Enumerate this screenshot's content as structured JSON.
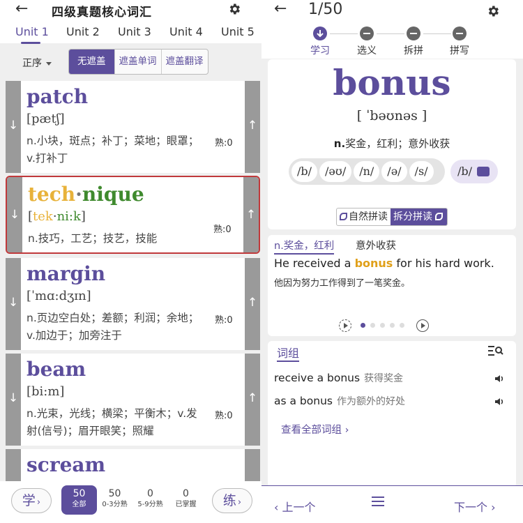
{
  "left": {
    "back_icon": "arrow-left-icon",
    "title": "四级真题核心词汇",
    "settings_icon": "gear-icon",
    "units": [
      "Unit 1",
      "Unit 2",
      "Unit 3",
      "Unit 4",
      "Unit 5"
    ],
    "active_unit": "Unit 1",
    "order_label": "正序",
    "cover_options": [
      "无遮盖",
      "遮盖单词",
      "遮盖翻译"
    ],
    "active_cover": "无遮盖",
    "words": [
      {
        "word": "patch",
        "phonetic": "[pætʃ]",
        "definition": "n.小块，斑点；补丁；菜地；眼罩；v.打补丁",
        "familiarity": "熟:0"
      },
      {
        "word_part1": "tech",
        "word_sep": "·",
        "word_part2": "nique",
        "phon_open": "[",
        "phon_part1": "tek",
        "phon_sep": "·",
        "phon_part2": "ni:k",
        "phon_close": "]",
        "definition": "n.技巧，工艺；技艺，技能",
        "familiarity": "熟:0"
      },
      {
        "word": "margin",
        "phonetic": "[ˈmɑ:dʒɪn]",
        "definition": "n.页边空白处；差额；利润；余地；v.加边于；加旁注于",
        "familiarity": "熟:0"
      },
      {
        "word": "beam",
        "phonetic": "[bi:m]",
        "definition": "n.光束，光线；横梁；平衡木；v.发射(信号)；眉开眼笑；照耀",
        "familiarity": "熟:0"
      },
      {
        "word": "scream"
      }
    ],
    "learn_button": "学",
    "practice_button": "练",
    "stats": [
      {
        "value": "50",
        "label": "全部"
      },
      {
        "value": "50",
        "label": "0-3分熟"
      },
      {
        "value": "0",
        "label": "5-9分熟"
      },
      {
        "value": "0",
        "label": "已掌握"
      }
    ]
  },
  "right": {
    "back_icon": "arrow-left-icon",
    "counter": "1/50",
    "settings_icon": "gear-icon",
    "steps": [
      "学习",
      "选义",
      "拆拼",
      "拼写"
    ],
    "active_step": "学习",
    "word": "bonus",
    "phonetic": "[ ˈbəʊnəs ]",
    "definition_pos": "n.",
    "definition": "奖金，红利；意外收获",
    "phonemes": [
      "/b/",
      "/əʊ/",
      "/n/",
      "/ə/",
      "/s/"
    ],
    "phoneme_alt": "/b/",
    "spell_modes": [
      "自然拼读",
      "拆分拼读"
    ],
    "active_spell_mode": "拆分拼读",
    "example": {
      "sense_active": "n.奖金，红利",
      "sense_other": "意外收获",
      "en_before": "He received a ",
      "en_highlight": "bonus",
      "en_after": " for his hard work.",
      "cn": "他因为努力工作得到了一笔奖金。",
      "page_count": 5,
      "current_page": 1
    },
    "phrases": {
      "title": "词组",
      "items": [
        {
          "en": "receive a bonus",
          "cn": "获得奖金"
        },
        {
          "en": "as a bonus",
          "cn": "作为额外的好处"
        }
      ],
      "more": "查看全部词组"
    },
    "nav": {
      "prev": "上一个",
      "next": "下一个"
    }
  },
  "colors": {
    "accent": "#5c4e9c",
    "highlight": "#e0a01a",
    "selected_border": "#c0393b",
    "syll1": "#e8b23a",
    "syll2": "#3f8a2e"
  }
}
